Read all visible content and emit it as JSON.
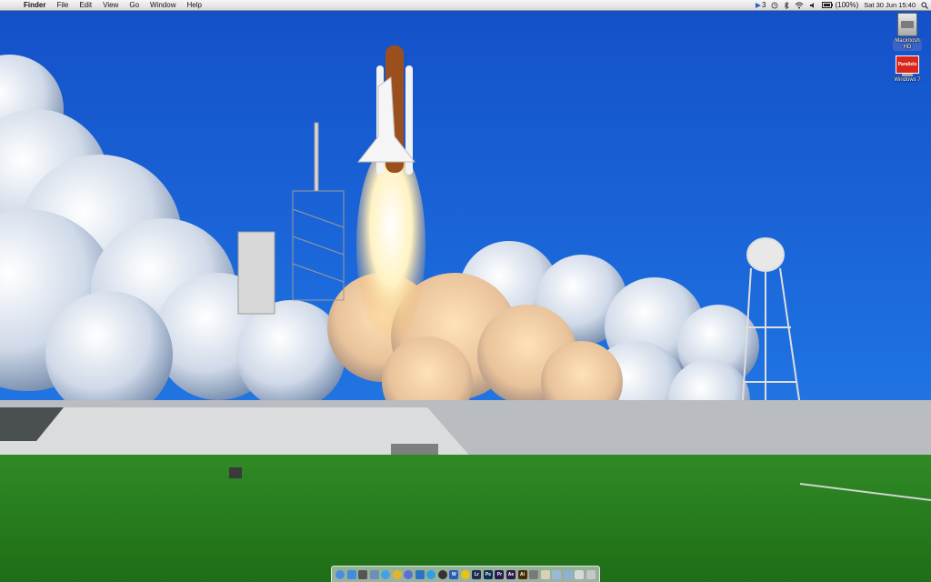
{
  "menubar": {
    "apple_glyph": "",
    "app_name": "Finder",
    "menus": [
      "File",
      "Edit",
      "View",
      "Go",
      "Window",
      "Help"
    ],
    "status": {
      "notification_count": "3",
      "battery_text": "(100%)",
      "clock": "Sat 30 Jun  15:40"
    }
  },
  "desktop_icons": [
    {
      "label_line1": "Macintosh",
      "label_line2": "HD"
    },
    {
      "glyph_text": "Parallels",
      "label_line1": "Windows 7"
    }
  ],
  "dock": {
    "items": [
      {
        "icon": "finder-icon",
        "color": "#4a8de0",
        "text": ""
      },
      {
        "icon": "app-store-icon",
        "color": "#3b8ee0",
        "text": ""
      },
      {
        "icon": "dashboard-icon",
        "color": "#555555",
        "text": ""
      },
      {
        "icon": "mail-icon",
        "color": "#6d8fb8",
        "text": ""
      },
      {
        "icon": "safari-icon",
        "color": "#3fa2e8",
        "text": ""
      },
      {
        "icon": "chrome-icon",
        "color": "#e4b431",
        "text": ""
      },
      {
        "icon": "itunes-icon",
        "color": "#5b6fd6",
        "text": ""
      },
      {
        "icon": "iphoto-icon",
        "color": "#2f72c4",
        "text": ""
      },
      {
        "icon": "skype-icon",
        "color": "#2ea0e0",
        "text": ""
      },
      {
        "icon": "steam-icon",
        "color": "#333333",
        "text": ""
      },
      {
        "icon": "word-icon",
        "color": "#2b5db8",
        "text": "W"
      },
      {
        "icon": "norton-icon",
        "color": "#e6c21c",
        "text": ""
      },
      {
        "icon": "lightroom-icon",
        "color": "#1d2f4f",
        "text": "Lr"
      },
      {
        "icon": "photoshop-icon",
        "color": "#0f2f57",
        "text": "Ps"
      },
      {
        "icon": "premiere-icon",
        "color": "#2a1a50",
        "text": "Pr"
      },
      {
        "icon": "after-effects-icon",
        "color": "#2b1c4e",
        "text": "Ae"
      },
      {
        "icon": "illustrator-icon",
        "color": "#4a2a05",
        "text": "Ai"
      },
      {
        "icon": "system-preferences-icon",
        "color": "#7a7a7a",
        "text": ""
      },
      {
        "icon": "text-edit-icon",
        "color": "#d9d0b8",
        "text": ""
      },
      {
        "icon": "folder-icon",
        "color": "#9ab8d8",
        "text": ""
      },
      {
        "icon": "downloads-icon",
        "color": "#8fb0d4",
        "text": ""
      },
      {
        "icon": "documents-icon",
        "color": "#d8d8d8",
        "text": ""
      },
      {
        "icon": "trash-icon",
        "color": "#c4c7cc",
        "text": ""
      }
    ]
  },
  "wallpaper": {
    "subject": "space-shuttle-launch"
  }
}
